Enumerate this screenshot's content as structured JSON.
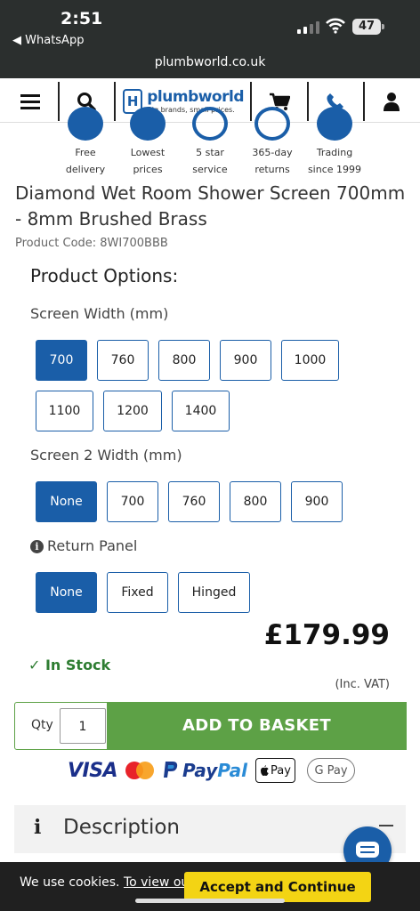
{
  "status_bar": {
    "time": "2:51",
    "back_app": "◀ WhatsApp",
    "battery": "47",
    "url": "plumbworld.co.uk"
  },
  "nav": {
    "logo": {
      "mark": "H",
      "name": "plumbworld",
      "tagline": "Big brands, small prices."
    },
    "icons": [
      "menu-icon",
      "search-icon",
      "cart-icon",
      "phone-icon",
      "account-icon"
    ]
  },
  "usps": [
    {
      "line1": "Free",
      "line2": "delivery"
    },
    {
      "line1": "Lowest",
      "line2": "prices"
    },
    {
      "line1": "5 star",
      "line2": "service"
    },
    {
      "line1": "365-day",
      "line2": "returns"
    },
    {
      "line1": "Trading",
      "line2": "since 1999"
    }
  ],
  "product": {
    "title": "Diamond Wet Room Shower Screen 700mm - 8mm Brushed Brass",
    "code": "Product Code: 8WI700BBB"
  },
  "options": {
    "heading": "Product Options:",
    "screen_width": {
      "label": "Screen Width (mm)",
      "values": [
        "700",
        "760",
        "800",
        "900",
        "1000",
        "1100",
        "1200",
        "1400"
      ],
      "selected": "700"
    },
    "screen2_width": {
      "label": "Screen 2 Width (mm)",
      "values": [
        "None",
        "700",
        "760",
        "800",
        "900"
      ],
      "selected": "None"
    },
    "return_panel": {
      "label": "Return Panel",
      "values": [
        "None",
        "Fixed",
        "Hinged"
      ],
      "selected": "None"
    }
  },
  "pricing": {
    "price": "£179.99",
    "stock": "✓ In Stock",
    "vat_note": "(Inc. VAT)"
  },
  "basket": {
    "qty_label": "Qty",
    "qty_value": "1",
    "button": "ADD TO BASKET"
  },
  "payments": {
    "visa": "VISA",
    "paypal_a": "Pay",
    "paypal_b": "Pal",
    "applepay": "Pay",
    "gpay": "G Pay"
  },
  "description": {
    "label": "Description"
  },
  "cookie": {
    "text": "We use cookies.",
    "link": "To view ou",
    "button": "Accept and Continue"
  },
  "colors": {
    "brand_blue": "#1a5ea8",
    "basket_green": "#5da146",
    "accept_yellow": "#f3d414",
    "stock_green": "#2e7d32"
  }
}
